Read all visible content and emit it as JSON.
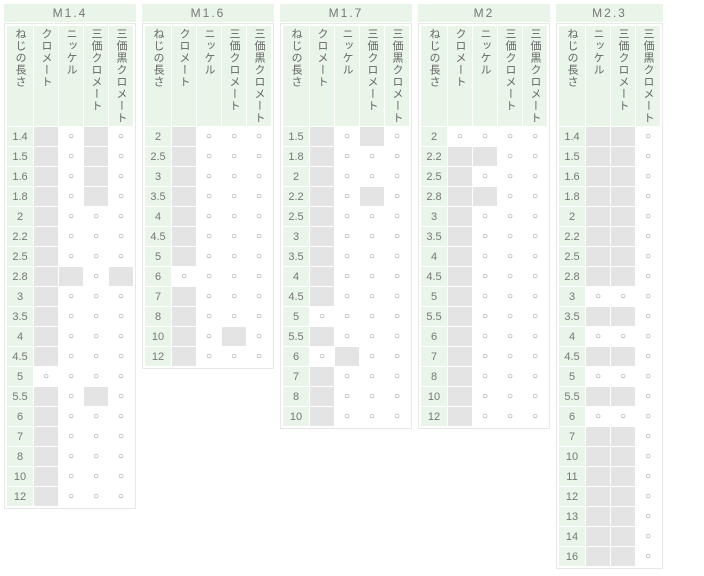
{
  "mark": "○",
  "tables": [
    {
      "title": "M1.4",
      "columns": [
        "ねじの長さ",
        "クロメート",
        "ニッケル",
        "三価クロメート",
        "三価黒クロメート"
      ],
      "rows": [
        {
          "len": "1.4",
          "v": [
            0,
            1,
            0,
            1
          ]
        },
        {
          "len": "1.5",
          "v": [
            0,
            1,
            0,
            1
          ]
        },
        {
          "len": "1.6",
          "v": [
            0,
            1,
            0,
            1
          ]
        },
        {
          "len": "1.8",
          "v": [
            0,
            1,
            0,
            1
          ]
        },
        {
          "len": "2",
          "v": [
            0,
            1,
            1,
            1
          ]
        },
        {
          "len": "2.2",
          "v": [
            0,
            1,
            1,
            1
          ]
        },
        {
          "len": "2.5",
          "v": [
            0,
            1,
            1,
            1
          ]
        },
        {
          "len": "2.8",
          "v": [
            0,
            0,
            1,
            0
          ]
        },
        {
          "len": "3",
          "v": [
            0,
            1,
            1,
            1
          ]
        },
        {
          "len": "3.5",
          "v": [
            0,
            1,
            1,
            1
          ]
        },
        {
          "len": "4",
          "v": [
            0,
            1,
            1,
            1
          ]
        },
        {
          "len": "4.5",
          "v": [
            0,
            1,
            1,
            1
          ]
        },
        {
          "len": "5",
          "v": [
            1,
            1,
            1,
            1
          ]
        },
        {
          "len": "5.5",
          "v": [
            0,
            1,
            0,
            1
          ]
        },
        {
          "len": "6",
          "v": [
            0,
            1,
            1,
            1
          ]
        },
        {
          "len": "7",
          "v": [
            0,
            1,
            1,
            1
          ]
        },
        {
          "len": "8",
          "v": [
            0,
            1,
            1,
            1
          ]
        },
        {
          "len": "10",
          "v": [
            0,
            1,
            1,
            1
          ]
        },
        {
          "len": "12",
          "v": [
            0,
            1,
            1,
            1
          ]
        }
      ]
    },
    {
      "title": "M1.6",
      "columns": [
        "ねじの長さ",
        "クロメート",
        "ニッケル",
        "三価クロメート",
        "三価黒クロメート"
      ],
      "rows": [
        {
          "len": "2",
          "v": [
            0,
            1,
            1,
            1
          ]
        },
        {
          "len": "2.5",
          "v": [
            0,
            1,
            1,
            1
          ]
        },
        {
          "len": "3",
          "v": [
            0,
            1,
            1,
            1
          ]
        },
        {
          "len": "3.5",
          "v": [
            0,
            1,
            1,
            1
          ]
        },
        {
          "len": "4",
          "v": [
            0,
            1,
            1,
            1
          ]
        },
        {
          "len": "4.5",
          "v": [
            0,
            1,
            1,
            1
          ]
        },
        {
          "len": "5",
          "v": [
            0,
            1,
            1,
            1
          ]
        },
        {
          "len": "6",
          "v": [
            1,
            1,
            1,
            1
          ]
        },
        {
          "len": "7",
          "v": [
            0,
            1,
            1,
            1
          ]
        },
        {
          "len": "8",
          "v": [
            0,
            1,
            1,
            1
          ]
        },
        {
          "len": "10",
          "v": [
            0,
            1,
            0,
            1
          ]
        },
        {
          "len": "12",
          "v": [
            0,
            1,
            1,
            1
          ]
        }
      ]
    },
    {
      "title": "M1.7",
      "columns": [
        "ねじの長さ",
        "クロメート",
        "ニッケル",
        "三価クロメート",
        "三価黒クロメート"
      ],
      "rows": [
        {
          "len": "1.5",
          "v": [
            0,
            1,
            0,
            1
          ]
        },
        {
          "len": "1.8",
          "v": [
            0,
            1,
            1,
            1
          ]
        },
        {
          "len": "2",
          "v": [
            0,
            1,
            1,
            1
          ]
        },
        {
          "len": "2.2",
          "v": [
            0,
            1,
            0,
            1
          ]
        },
        {
          "len": "2.5",
          "v": [
            0,
            1,
            1,
            1
          ]
        },
        {
          "len": "3",
          "v": [
            0,
            1,
            1,
            1
          ]
        },
        {
          "len": "3.5",
          "v": [
            0,
            1,
            1,
            1
          ]
        },
        {
          "len": "4",
          "v": [
            0,
            1,
            1,
            1
          ]
        },
        {
          "len": "4.5",
          "v": [
            0,
            1,
            1,
            1
          ]
        },
        {
          "len": "5",
          "v": [
            1,
            1,
            1,
            1
          ]
        },
        {
          "len": "5.5",
          "v": [
            0,
            1,
            1,
            1
          ]
        },
        {
          "len": "6",
          "v": [
            1,
            0,
            1,
            1
          ]
        },
        {
          "len": "7",
          "v": [
            0,
            1,
            1,
            1
          ]
        },
        {
          "len": "8",
          "v": [
            0,
            1,
            1,
            1
          ]
        },
        {
          "len": "10",
          "v": [
            0,
            1,
            1,
            1
          ]
        }
      ]
    },
    {
      "title": "M2",
      "columns": [
        "ねじの長さ",
        "クロメート",
        "ニッケル",
        "三価クロメート",
        "三価黒クロメート"
      ],
      "rows": [
        {
          "len": "2",
          "v": [
            1,
            1,
            1,
            1
          ]
        },
        {
          "len": "2.2",
          "v": [
            0,
            0,
            1,
            1
          ]
        },
        {
          "len": "2.5",
          "v": [
            0,
            1,
            1,
            1
          ]
        },
        {
          "len": "2.8",
          "v": [
            0,
            0,
            1,
            1
          ]
        },
        {
          "len": "3",
          "v": [
            0,
            1,
            1,
            1
          ]
        },
        {
          "len": "3.5",
          "v": [
            0,
            1,
            1,
            1
          ]
        },
        {
          "len": "4",
          "v": [
            0,
            1,
            1,
            1
          ]
        },
        {
          "len": "4.5",
          "v": [
            0,
            1,
            1,
            1
          ]
        },
        {
          "len": "5",
          "v": [
            0,
            1,
            1,
            1
          ]
        },
        {
          "len": "5.5",
          "v": [
            0,
            1,
            1,
            1
          ]
        },
        {
          "len": "6",
          "v": [
            0,
            1,
            1,
            1
          ]
        },
        {
          "len": "7",
          "v": [
            0,
            1,
            1,
            1
          ]
        },
        {
          "len": "8",
          "v": [
            0,
            1,
            1,
            1
          ]
        },
        {
          "len": "10",
          "v": [
            0,
            1,
            1,
            1
          ]
        },
        {
          "len": "12",
          "v": [
            0,
            1,
            1,
            1
          ]
        }
      ]
    },
    {
      "title": "M2.3",
      "columns": [
        "ねじの長さ",
        "ニッケル",
        "三価クロメート",
        "三価黒クロメート"
      ],
      "rows": [
        {
          "len": "1.4",
          "v": [
            0,
            0,
            1
          ]
        },
        {
          "len": "1.5",
          "v": [
            0,
            0,
            1
          ]
        },
        {
          "len": "1.6",
          "v": [
            0,
            0,
            1
          ]
        },
        {
          "len": "1.8",
          "v": [
            0,
            0,
            1
          ]
        },
        {
          "len": "2",
          "v": [
            0,
            0,
            1
          ]
        },
        {
          "len": "2.2",
          "v": [
            0,
            0,
            1
          ]
        },
        {
          "len": "2.5",
          "v": [
            0,
            0,
            1
          ]
        },
        {
          "len": "2.8",
          "v": [
            0,
            0,
            1
          ]
        },
        {
          "len": "3",
          "v": [
            1,
            1,
            1
          ]
        },
        {
          "len": "3.5",
          "v": [
            0,
            0,
            1
          ]
        },
        {
          "len": "4",
          "v": [
            1,
            1,
            1
          ]
        },
        {
          "len": "4.5",
          "v": [
            0,
            0,
            1
          ]
        },
        {
          "len": "5",
          "v": [
            1,
            1,
            1
          ]
        },
        {
          "len": "5.5",
          "v": [
            0,
            0,
            1
          ]
        },
        {
          "len": "6",
          "v": [
            1,
            1,
            1
          ]
        },
        {
          "len": "7",
          "v": [
            0,
            0,
            1
          ]
        },
        {
          "len": "10",
          "v": [
            0,
            0,
            1
          ]
        },
        {
          "len": "11",
          "v": [
            0,
            0,
            1
          ]
        },
        {
          "len": "12",
          "v": [
            0,
            0,
            1
          ]
        },
        {
          "len": "13",
          "v": [
            0,
            0,
            1
          ]
        },
        {
          "len": "14",
          "v": [
            0,
            0,
            1
          ]
        },
        {
          "len": "16",
          "v": [
            0,
            0,
            1
          ]
        }
      ]
    }
  ]
}
